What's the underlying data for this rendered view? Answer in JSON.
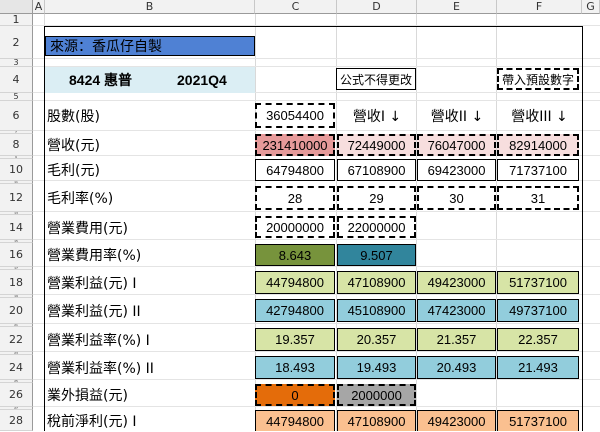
{
  "columns": [
    "A",
    "B",
    "C",
    "D",
    "E",
    "F",
    "G"
  ],
  "rows": [
    "1",
    "2",
    "3",
    "4",
    "5",
    "6",
    "7",
    "8",
    "9",
    "10",
    "11",
    "12",
    "13",
    "14",
    "15",
    "16",
    "17",
    "18",
    "19",
    "20",
    "21",
    "22",
    "23",
    "24",
    "25",
    "26",
    "27",
    "28"
  ],
  "source_label": "來源：香瓜仔自製",
  "stock_code": "8424 惠普",
  "period": "2021Q4",
  "note_formula": "公式不得更改",
  "note_default": "帶入預設數字",
  "labels": {
    "shares": "股數(股)",
    "revenue": "營收(元)",
    "gross_profit": "毛利(元)",
    "gross_margin": "毛利率(%)",
    "op_expense": "營業費用(元)",
    "op_expense_rate": "營業費用率(%)",
    "op_income_1": "營業利益(元) I",
    "op_income_2": "營業利益(元) II",
    "op_margin_1": "營業利益率(%) I",
    "op_margin_2": "營業利益率(%) II",
    "non_op": "業外損益(元)",
    "pretax_1": "稅前淨利(元) I"
  },
  "values": {
    "shares": "36054400",
    "rev_h1": "營收I ↓",
    "rev_h2": "營收II ↓",
    "rev_h3": "營收III ↓",
    "revenue": [
      "231410000",
      "72449000",
      "76047000",
      "82914000"
    ],
    "gross_profit": [
      "64794800",
      "67108900",
      "69423000",
      "71737100"
    ],
    "gross_margin": [
      "28",
      "29",
      "30",
      "31"
    ],
    "op_expense": [
      "20000000",
      "22000000"
    ],
    "op_expense_rate": [
      "8.643",
      "9.507"
    ],
    "op_income_1": [
      "44794800",
      "47108900",
      "49423000",
      "51737100"
    ],
    "op_income_2": [
      "42794800",
      "45108900",
      "47423000",
      "49737100"
    ],
    "op_margin_1": [
      "19.357",
      "20.357",
      "21.357",
      "22.357"
    ],
    "op_margin_2": [
      "18.493",
      "19.493",
      "20.493",
      "21.493"
    ],
    "non_op": [
      "0",
      "2000000"
    ],
    "pretax_1": [
      "44794800",
      "47108900",
      "49423000",
      "51737100"
    ]
  },
  "colors": {
    "source_bg": "#4f81d4",
    "info_bg": "#dbeef4",
    "revenue_main": "#e69a9a",
    "revenue_light": "#f7dede",
    "op_exp_rate_1": "#77933c",
    "op_exp_rate_2": "#31859c",
    "green": "#d7e4a6",
    "blue": "#92cddc",
    "orange": "#e46c0a",
    "gray": "#a6a6a6",
    "peach": "#fac090"
  }
}
